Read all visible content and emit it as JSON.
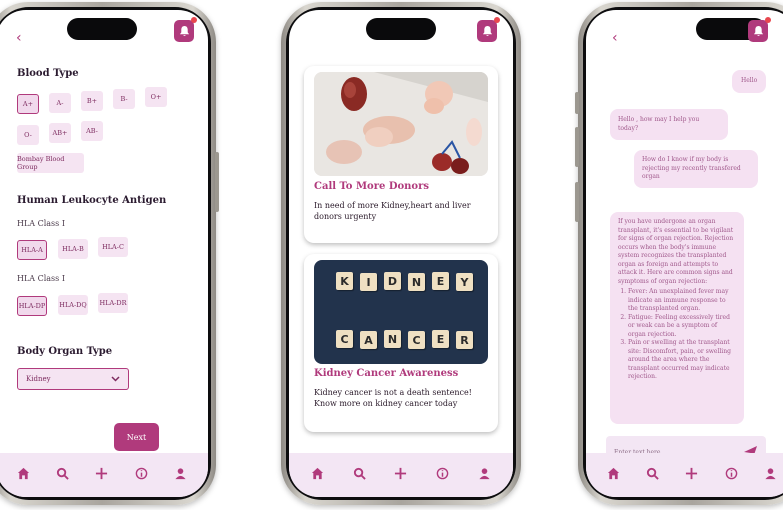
{
  "colors": {
    "accent": "#b03a7c",
    "chip_bg": "#f5e4f2",
    "tabbar_bg": "#f3e6f4",
    "bubble_bg": "#f5e1f2"
  },
  "tabbar": {
    "icons": [
      "home-icon",
      "search-icon",
      "add-icon",
      "info-icon",
      "profile-icon"
    ]
  },
  "screen1": {
    "back": "‹",
    "blood_type": {
      "title": "Blood Type",
      "options": [
        "A+",
        "A-",
        "B+",
        "B-",
        "O+",
        "O-",
        "AB+",
        "AB-",
        "Bombay Blood Group"
      ],
      "selected": "A+"
    },
    "hla": {
      "title": "Human Leukocyte Antigen",
      "class1": {
        "label": "HLA Class I",
        "options": [
          "HLA-A",
          "HLA-B",
          "HLA-C"
        ],
        "selected": "HLA-A"
      },
      "class2": {
        "label": "HLA Class I",
        "options": [
          "HLA-DP",
          "HLA-DQ",
          "HLA-DR"
        ],
        "selected": "HLA-DP"
      }
    },
    "organ": {
      "title": "Body Organ Type",
      "value": "Kidney"
    },
    "next_label": "Next"
  },
  "screen2": {
    "cards": [
      {
        "title": "Call To More Donors",
        "description": "In need of more Kidney,heart and liver donors urgenty"
      },
      {
        "title": "Kidney Cancer Awareness",
        "description": "Kidney cancer is not a death sentence! Know more on kidney cancer today"
      }
    ],
    "tiles_row1": [
      "K",
      "I",
      "D",
      "N",
      "E",
      "Y"
    ],
    "tiles_row2": [
      "C",
      "A",
      "N",
      "C",
      "E",
      "R"
    ]
  },
  "screen3": {
    "back": "‹",
    "messages": [
      {
        "from": "user",
        "text": "Hello"
      },
      {
        "from": "bot",
        "text": "Hello , how may I help you today?"
      },
      {
        "from": "user",
        "text": "How do I know if my body is rejecting my recently transfered organ"
      },
      {
        "from": "bot",
        "intro": "If you have undergone an organ transplant, it's essential to be vigilant for signs of organ rejection. Rejection occurs when the body's immune system recognizes the transplanted organ as foreign and attempts to attack it. Here are common signs and symptoms of organ rejection:",
        "points": [
          "Fever: An unexplained fever may indicate an immune response to the transplanted organ.",
          "Fatigue: Feeling excessively tired or weak can be a symptom of organ rejection.",
          "Pain or swelling at the transplant site: Discomfort, pain, or swelling around the area where the transplant occurred may indicate rejection."
        ]
      }
    ],
    "input_placeholder": "Enter text here ...."
  }
}
